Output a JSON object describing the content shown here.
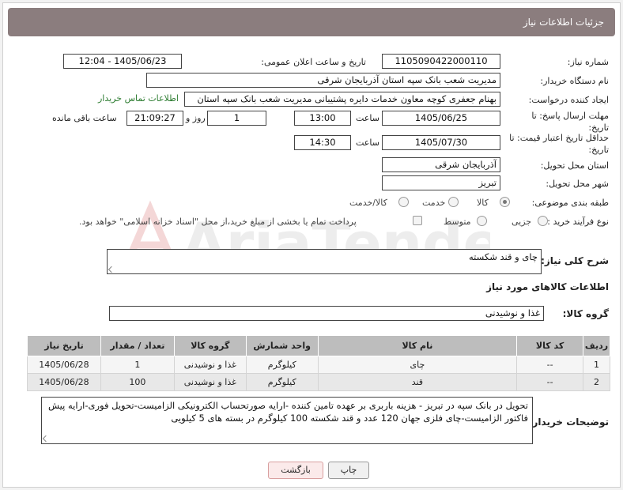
{
  "header": {
    "title": "جزئیات اطلاعات نیاز"
  },
  "form": {
    "need_number": {
      "label": "شماره نیاز:",
      "value": "1105090422000110"
    },
    "announce_datetime": {
      "label": "تاریخ و ساعت اعلان عمومی:",
      "value": "1405/06/23 - 12:04"
    },
    "buyer_org": {
      "label": "نام دستگاه خریدار:",
      "value": "مدیریت شعب بانک سپه استان آذربایجان شرقی"
    },
    "requester": {
      "label": "ایجاد کننده درخواست:",
      "value": "بهنام جعفری کوچه معاون خدمات دایره پشتیبانی مدیریت شعب بانک سپه استان",
      "contact_link": "اطلاعات تماس خریدار"
    },
    "reply_deadline": {
      "label": "مهلت ارسال پاسخ: تا تاریخ:",
      "date": "1405/06/25",
      "time_label": "ساعت",
      "time": "13:00",
      "days": "1",
      "days_label": "روز و",
      "remaining": "21:09:27",
      "remaining_label": "ساعت باقی مانده"
    },
    "price_validity": {
      "label": "حداقل تاریخ اعتبار قیمت: تا تاریخ:",
      "date": "1405/07/30",
      "time_label": "ساعت",
      "time": "14:30"
    },
    "delivery_province": {
      "label": "استان محل تحویل:",
      "value": "آذربایجان شرقی"
    },
    "delivery_city": {
      "label": "شهر محل تحویل:",
      "value": "تبریز"
    },
    "category": {
      "label": "طبقه بندی موضوعی:",
      "options": [
        "کالا",
        "خدمت",
        "کالا/خدمت"
      ],
      "selected": "کالا"
    },
    "process": {
      "label": "نوع فرآیند خرید :",
      "options": [
        "جزیی",
        "متوسط"
      ],
      "payment_note": "پرداخت تمام یا بخشی از مبلغ خرید،از محل \"اسناد خزانه اسلامی\" خواهد بود."
    }
  },
  "summary": {
    "label": "شرح کلی نیاز:",
    "value": "چای و قند شکسته"
  },
  "goods": {
    "title": "اطلاعات کالاهای مورد نیاز",
    "group_label": "گروه کالا:",
    "group_value": "غذا و نوشیدنی",
    "columns": [
      "ردیف",
      "کد کالا",
      "نام کالا",
      "واحد شمارش",
      "گروه کالا",
      "تعداد / مقدار",
      "تاریخ نیاز"
    ],
    "rows": [
      {
        "row": "1",
        "code": "--",
        "name": "چای",
        "unit": "کیلوگرم",
        "group": "غذا و نوشیدنی",
        "qty": "1",
        "date": "1405/06/28"
      },
      {
        "row": "2",
        "code": "--",
        "name": "قند",
        "unit": "کیلوگرم",
        "group": "غذا و نوشیدنی",
        "qty": "100",
        "date": "1405/06/28"
      }
    ]
  },
  "buyer_notes": {
    "label": "توضیحات خریدار:",
    "value": "تحویل در بانک سپه در تبریز - هزینه باربری بر عهده تامین کننده -ارایه صورتحساب الکترونیکی الزامیست-تحویل فوری-ارایه پیش فاکتور الزامیست-چای فلزی جهان 120 عدد و قند شکسته 100 کیلوگرم در بسته های 5 کیلویی"
  },
  "buttons": {
    "print": "چاپ",
    "back": "بازگشت"
  },
  "watermark": {
    "text": "AriaTender.net"
  },
  "colors": {
    "header_bg": "#8b7d7e",
    "link": "#2e7d32",
    "table_header": "#bdbdbd",
    "back_button_border": "#d9a0a0"
  }
}
